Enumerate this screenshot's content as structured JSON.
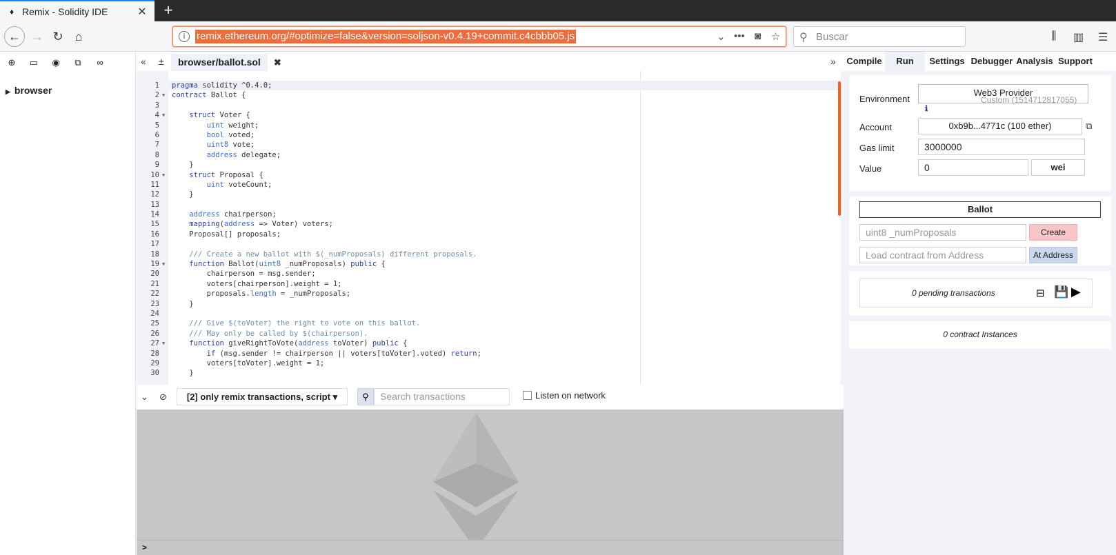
{
  "browser": {
    "tab_title": "Remix - Solidity IDE",
    "url": "remix.ethereum.org/#optimize=false&version=soljson-v0.4.19+commit.c4cbbb05.js",
    "search_placeholder": "Buscar"
  },
  "filepanel": {
    "tree_root": "browser"
  },
  "editor": {
    "active_file": "browser/ballot.sol",
    "lines": [
      {
        "n": "1",
        "t": "pragma solidity ^0.4.0;"
      },
      {
        "n": "2",
        "t": "contract Ballot {",
        "fold": true
      },
      {
        "n": "3",
        "t": ""
      },
      {
        "n": "4",
        "t": "    struct Voter {",
        "fold": true
      },
      {
        "n": "5",
        "t": "        uint weight;"
      },
      {
        "n": "6",
        "t": "        bool voted;"
      },
      {
        "n": "7",
        "t": "        uint8 vote;"
      },
      {
        "n": "8",
        "t": "        address delegate;"
      },
      {
        "n": "9",
        "t": "    }"
      },
      {
        "n": "10",
        "t": "    struct Proposal {",
        "fold": true
      },
      {
        "n": "11",
        "t": "        uint voteCount;"
      },
      {
        "n": "12",
        "t": "    }"
      },
      {
        "n": "13",
        "t": ""
      },
      {
        "n": "14",
        "t": "    address chairperson;"
      },
      {
        "n": "15",
        "t": "    mapping(address => Voter) voters;"
      },
      {
        "n": "16",
        "t": "    Proposal[] proposals;"
      },
      {
        "n": "17",
        "t": ""
      },
      {
        "n": "18",
        "t": "    /// Create a new ballot with $(_numProposals) different proposals."
      },
      {
        "n": "19",
        "t": "    function Ballot(uint8 _numProposals) public {",
        "fold": true
      },
      {
        "n": "20",
        "t": "        chairperson = msg.sender;"
      },
      {
        "n": "21",
        "t": "        voters[chairperson].weight = 1;"
      },
      {
        "n": "22",
        "t": "        proposals.length = _numProposals;"
      },
      {
        "n": "23",
        "t": "    }"
      },
      {
        "n": "24",
        "t": ""
      },
      {
        "n": "25",
        "t": "    /// Give $(toVoter) the right to vote on this ballot."
      },
      {
        "n": "26",
        "t": "    /// May only be called by $(chairperson)."
      },
      {
        "n": "27",
        "t": "    function giveRightToVote(address toVoter) public {",
        "fold": true
      },
      {
        "n": "28",
        "t": "        if (msg.sender != chairperson || voters[toVoter].voted) return;"
      },
      {
        "n": "29",
        "t": "        voters[toVoter].weight = 1;"
      },
      {
        "n": "30",
        "t": "    }"
      }
    ]
  },
  "terminal": {
    "filter_label": "[2] only remix transactions, script",
    "search_placeholder": "Search transactions",
    "listen_label": "Listen on network",
    "prompt": ">"
  },
  "runpanel": {
    "tabs": [
      "Compile",
      "Run",
      "Settings",
      "Debugger",
      "Analysis",
      "Support"
    ],
    "active_tab": "Run",
    "environment_label": "Environment",
    "environment_value": "Web3 Provider",
    "environment_sub": "Custom (1514712817055)",
    "account_label": "Account",
    "account_value": "0xb9b...4771c (100 ether)",
    "gaslimit_label": "Gas limit",
    "gaslimit_value": "3000000",
    "value_label": "Value",
    "value_value": "0",
    "value_unit": "wei",
    "contract_select": "Ballot",
    "create_placeholder": "uint8 _numProposals",
    "create_button": "Create",
    "address_placeholder": "Load contract from Address",
    "ataddress_button": "At Address",
    "pending": "0 pending transactions",
    "instances": "0 contract Instances"
  }
}
